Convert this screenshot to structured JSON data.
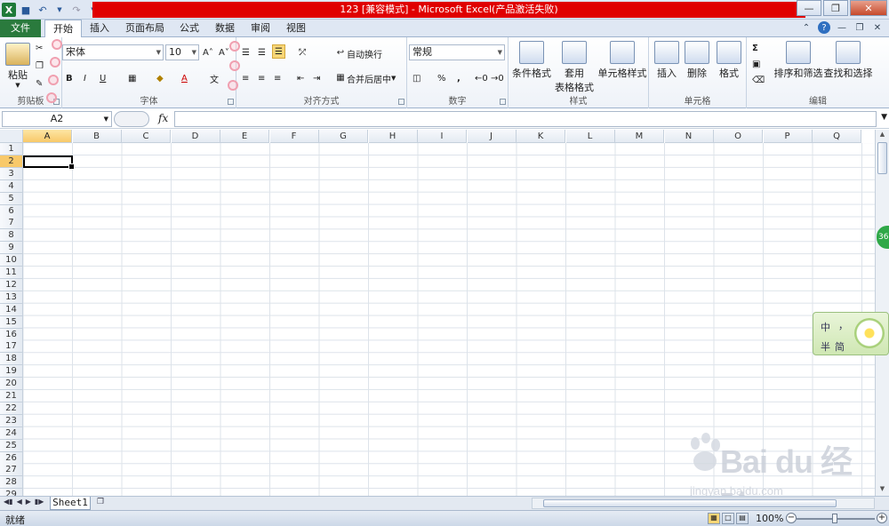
{
  "window": {
    "title": "123  [兼容模式]  -  Microsoft Excel(产品激活失败)"
  },
  "tabs": {
    "file": "文件",
    "items": [
      "开始",
      "插入",
      "页面布局",
      "公式",
      "数据",
      "审阅",
      "视图"
    ],
    "active": "开始"
  },
  "ribbon": {
    "clipboard": {
      "paste": "粘贴",
      "label": "剪贴板"
    },
    "font": {
      "name": "宋体",
      "size": "10",
      "bold": "B",
      "italic": "I",
      "underline": "U",
      "label": "字体"
    },
    "alignment": {
      "wrap": "自动换行",
      "merge": "合并后居中",
      "label": "对齐方式"
    },
    "number": {
      "format": "常规",
      "percent": "%",
      "comma": ",",
      "label": "数字"
    },
    "styles": {
      "conditional": "条件格式",
      "table1": "套用",
      "table2": "表格格式",
      "cell": "单元格样式",
      "label": "样式"
    },
    "cells": {
      "insert": "插入",
      "delete": "删除",
      "format": "格式",
      "label": "单元格"
    },
    "editing": {
      "sort": "排序和筛选",
      "find": "查找和选择",
      "label": "编辑",
      "sigma": "Σ"
    }
  },
  "formula_bar": {
    "name_box": "A2",
    "fx": "fx",
    "value": ""
  },
  "grid": {
    "columns": [
      "A",
      "B",
      "C",
      "D",
      "E",
      "F",
      "G",
      "H",
      "I",
      "J",
      "K",
      "L",
      "M",
      "N",
      "O",
      "P",
      "Q"
    ],
    "rows": [
      "1",
      "2",
      "3",
      "4",
      "5",
      "6",
      "7",
      "8",
      "9",
      "10",
      "11",
      "12",
      "13",
      "14",
      "15",
      "16",
      "17",
      "18",
      "19",
      "20",
      "21",
      "22",
      "23",
      "24",
      "25",
      "26",
      "27",
      "28",
      "29"
    ],
    "active_cell": "A2"
  },
  "sheets": [
    "Sheet1"
  ],
  "status": {
    "mode": "就绪",
    "zoom": "100%"
  },
  "ime": {
    "lang": "中",
    "punct": "，",
    "width": "半",
    "charset": "简"
  },
  "badge": "36",
  "watermark": {
    "main": "Bai du 经验",
    "sub": "jingyan.baidu.com"
  }
}
